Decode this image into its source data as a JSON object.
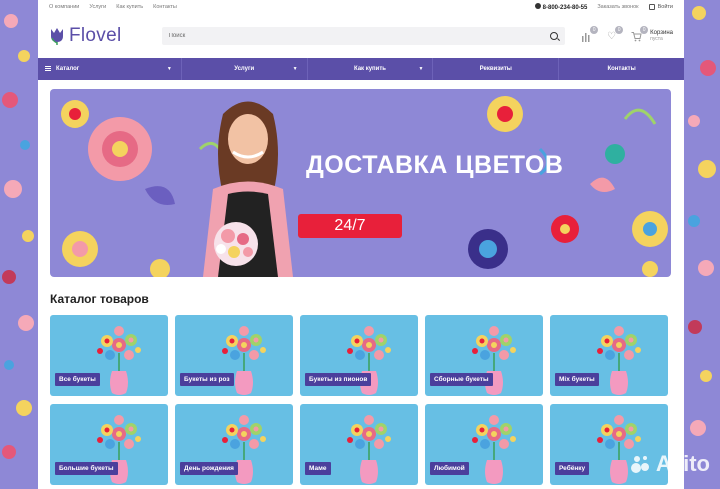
{
  "topbar": {
    "links": [
      "О компании",
      "Услуги",
      "Как купить",
      "Контакты"
    ],
    "phone": "8-800-234-80-55",
    "callback": "Заказать звонок",
    "login": "Войти"
  },
  "header": {
    "logo_text": "Flovel",
    "search_placeholder": "Поиск",
    "compare_count": "0",
    "favorites_count": "0",
    "cart_count": "0",
    "cart_label": "Корзина",
    "cart_status": "пуста"
  },
  "nav": {
    "items": [
      {
        "label": "Каталог",
        "dropdown": true
      },
      {
        "label": "Услуги",
        "dropdown": true
      },
      {
        "label": "Как купить",
        "dropdown": true
      },
      {
        "label": "Реквизиты",
        "dropdown": false
      },
      {
        "label": "Контакты",
        "dropdown": false
      }
    ]
  },
  "banner": {
    "title": "ДОСТАВКА ЦВЕТОВ",
    "badge": "24/7"
  },
  "catalog": {
    "title": "Каталог товаров",
    "items": [
      "Все букеты",
      "Букеты из роз",
      "Букеты из пионов",
      "Сборные букеты",
      "Mix букеты",
      "Большие букеты",
      "День рождения",
      "Маме",
      "Любимой",
      "Ребёнку"
    ]
  },
  "watermark": "Avito",
  "colors": {
    "brand": "#5b4fa8",
    "banner_bg": "#8e88d6",
    "badge_red": "#e8203a",
    "tile_bg": "#67bfe4",
    "tile_label_bg": "#4b3f9c"
  }
}
